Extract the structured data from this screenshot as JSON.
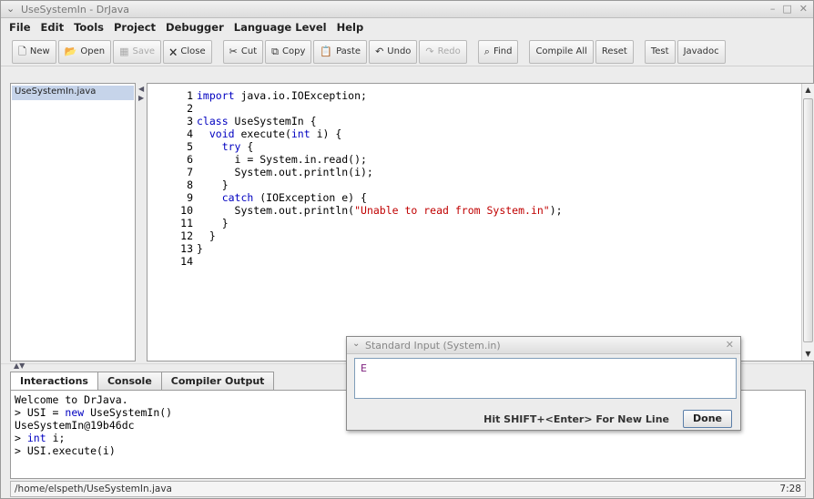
{
  "window": {
    "title": "UseSystemIn - DrJava",
    "sys_icon": "chevron-down-icon",
    "ctrls": [
      "–",
      "□",
      "✕"
    ]
  },
  "menubar": [
    "File",
    "Edit",
    "Tools",
    "Project",
    "Debugger",
    "Language Level",
    "Help"
  ],
  "toolbar": {
    "buttons": [
      {
        "label": "New",
        "icon": "new-file-icon",
        "glyph": "🗋",
        "enabled": true
      },
      {
        "label": "Open",
        "icon": "open-folder-icon",
        "glyph": "📂",
        "enabled": true
      },
      {
        "label": "Save",
        "icon": "save-icon",
        "glyph": "▦",
        "enabled": false
      },
      {
        "label": "Close",
        "icon": "close-file-icon",
        "glyph": "🗙",
        "enabled": true
      },
      {
        "label": "Cut",
        "icon": "scissors-icon",
        "glyph": "✂",
        "enabled": true
      },
      {
        "label": "Copy",
        "icon": "copy-icon",
        "glyph": "⧉",
        "enabled": true
      },
      {
        "label": "Paste",
        "icon": "paste-icon",
        "glyph": "📋",
        "enabled": true
      },
      {
        "label": "Undo",
        "icon": "undo-icon",
        "glyph": "↶",
        "enabled": true
      },
      {
        "label": "Redo",
        "icon": "redo-icon",
        "glyph": "↷",
        "enabled": false
      },
      {
        "label": "Find",
        "icon": "binoculars-icon",
        "glyph": "⌕",
        "enabled": true
      },
      {
        "label": "Compile All",
        "icon": "",
        "glyph": "",
        "enabled": true
      },
      {
        "label": "Reset",
        "icon": "",
        "glyph": "",
        "enabled": true
      },
      {
        "label": "Test",
        "icon": "",
        "glyph": "",
        "enabled": true
      },
      {
        "label": "Javadoc",
        "icon": "",
        "glyph": "",
        "enabled": true
      }
    ]
  },
  "file_list": {
    "items": [
      "UseSystemIn.java"
    ]
  },
  "editor": {
    "line_numbers": [
      "1",
      "2",
      "3",
      "4",
      "5",
      "6",
      "7",
      "8",
      "9",
      "10",
      "11",
      "12",
      "13",
      "14"
    ],
    "lines": [
      [
        {
          "t": "import",
          "k": "kw"
        },
        {
          "t": " java.io.IOException;"
        }
      ],
      [
        {
          "t": ""
        }
      ],
      [
        {
          "t": "class",
          "k": "kw"
        },
        {
          "t": " UseSystemIn {"
        }
      ],
      [
        {
          "t": "  "
        },
        {
          "t": "void",
          "k": "kw"
        },
        {
          "t": " execute("
        },
        {
          "t": "int",
          "k": "kw"
        },
        {
          "t": " i) {"
        }
      ],
      [
        {
          "t": "    "
        },
        {
          "t": "try",
          "k": "kw"
        },
        {
          "t": " {"
        }
      ],
      [
        {
          "t": "      i = System.in.read();"
        }
      ],
      [
        {
          "t": "      System.out.println(i);"
        }
      ],
      [
        {
          "t": "    }"
        }
      ],
      [
        {
          "t": "    "
        },
        {
          "t": "catch",
          "k": "kw"
        },
        {
          "t": " (IOException e) {"
        }
      ],
      [
        {
          "t": "      System.out.println("
        },
        {
          "t": "\"Unable to read from System.in\"",
          "k": "str"
        },
        {
          "t": ");"
        }
      ],
      [
        {
          "t": "    }"
        }
      ],
      [
        {
          "t": "  }"
        }
      ],
      [
        {
          "t": "}"
        }
      ],
      [
        {
          "t": ""
        }
      ]
    ]
  },
  "tabs": [
    "Interactions",
    "Console",
    "Compiler Output"
  ],
  "interactions": {
    "lines": [
      [
        {
          "t": "Welcome to DrJava."
        }
      ],
      [
        {
          "t": "> USI = "
        },
        {
          "t": "new",
          "k": "blue"
        },
        {
          "t": " UseSystemIn()"
        }
      ],
      [
        {
          "t": "UseSystemIn@19b46dc"
        }
      ],
      [
        {
          "t": "> "
        },
        {
          "t": "int",
          "k": "blue"
        },
        {
          "t": " i;"
        }
      ],
      [
        {
          "t": "> USI.execute(i)"
        }
      ]
    ]
  },
  "status": {
    "path": "/home/elspeth/UseSystemIn.java",
    "position": "7:28"
  },
  "dialog": {
    "title": "Standard Input (System.in)",
    "input_value": "E",
    "hint": "Hit SHIFT+<Enter> For New Line",
    "done_label": "Done",
    "close_glyph": "✕"
  }
}
